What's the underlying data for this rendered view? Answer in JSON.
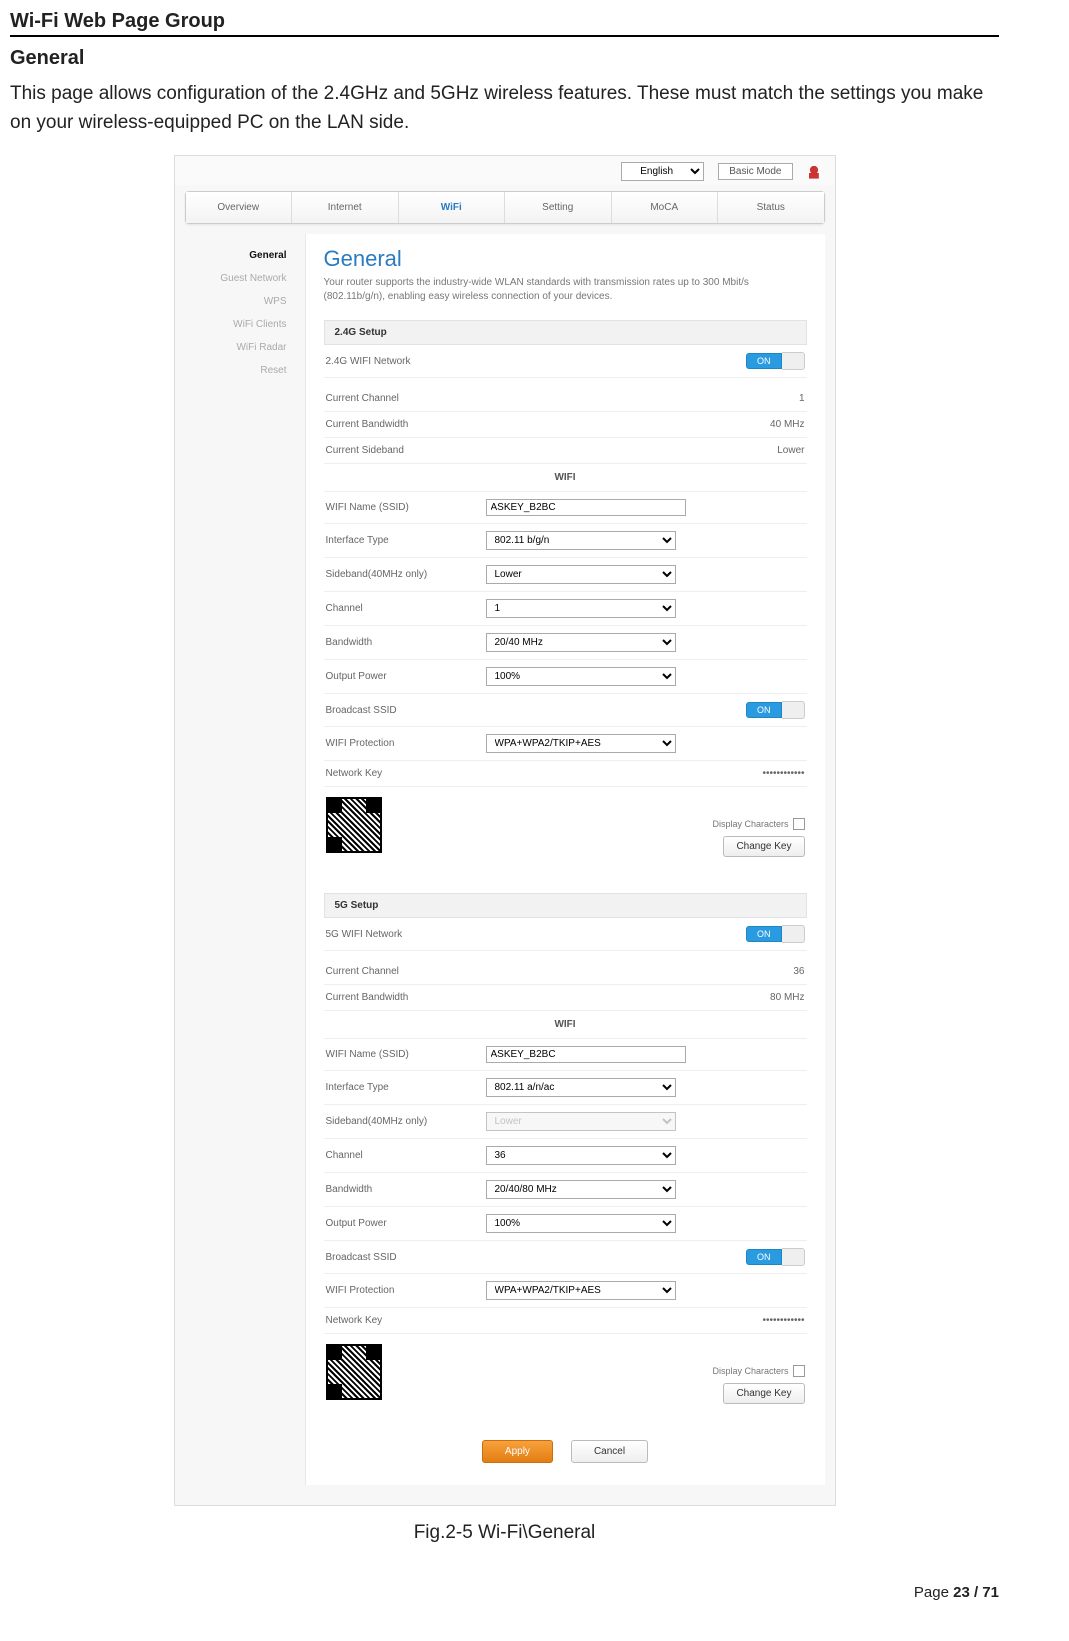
{
  "doc": {
    "title": "Wi-Fi Web Page Group",
    "sub": "General",
    "desc": "This page allows configuration of the 2.4GHz and 5GHz wireless features. These must match the settings you make on your wireless-equipped PC on the LAN side.",
    "caption": "Fig.2-5 Wi-Fi\\General",
    "footer_prefix": "Page ",
    "footer_page": "23 / 71"
  },
  "topbar": {
    "lang": "English",
    "mode": "Basic Mode"
  },
  "tabs": [
    "Overview",
    "Internet",
    "WiFi",
    "Setting",
    "MoCA",
    "Status"
  ],
  "active_tab": "WiFi",
  "sidebar": [
    "General",
    "Guest Network",
    "WPS",
    "WiFi Clients",
    "WiFi Radar",
    "Reset"
  ],
  "active_side": "General",
  "content": {
    "title": "General",
    "desc": "Your router supports the industry-wide WLAN standards with transmission rates up to 300 Mbit/s (802.11b/g/n), enabling easy wireless connection of your devices.",
    "wifi_subheader": "WIFI",
    "toggle_on": "ON",
    "display_chars": "Display Characters",
    "change_key": "Change Key",
    "apply": "Apply",
    "cancel": "Cancel",
    "g24": {
      "setup": "2.4G Setup",
      "net_label": "2.4G WIFI Network",
      "cc_label": "Current Channel",
      "cc": "1",
      "cb_label": "Current Bandwidth",
      "cb": "40 MHz",
      "cs_label": "Current Sideband",
      "cs": "Lower",
      "ssid_label": "WIFI Name (SSID)",
      "ssid": "ASKEY_B2BC",
      "itype_label": "Interface Type",
      "itype": "802.11 b/g/n",
      "sideband_label": "Sideband(40MHz only)",
      "sideband": "Lower",
      "channel_label": "Channel",
      "channel": "1",
      "bw_label": "Bandwidth",
      "bw": "20/40 MHz",
      "power_label": "Output Power",
      "power": "100%",
      "bssid_label": "Broadcast SSID",
      "prot_label": "WIFI Protection",
      "prot": "WPA+WPA2/TKIP+AES",
      "key_label": "Network Key",
      "key": "••••••••••••"
    },
    "g5": {
      "setup": "5G Setup",
      "net_label": "5G WIFI Network",
      "cc_label": "Current Channel",
      "cc": "36",
      "cb_label": "Current Bandwidth",
      "cb": "80 MHz",
      "ssid_label": "WIFI Name (SSID)",
      "ssid": "ASKEY_B2BC",
      "itype_label": "Interface Type",
      "itype": "802.11 a/n/ac",
      "sideband_label": "Sideband(40MHz only)",
      "sideband": "Lower",
      "channel_label": "Channel",
      "channel": "36",
      "bw_label": "Bandwidth",
      "bw": "20/40/80 MHz",
      "power_label": "Output Power",
      "power": "100%",
      "bssid_label": "Broadcast SSID",
      "prot_label": "WIFI Protection",
      "prot": "WPA+WPA2/TKIP+AES",
      "key_label": "Network Key",
      "key": "••••••••••••"
    }
  }
}
